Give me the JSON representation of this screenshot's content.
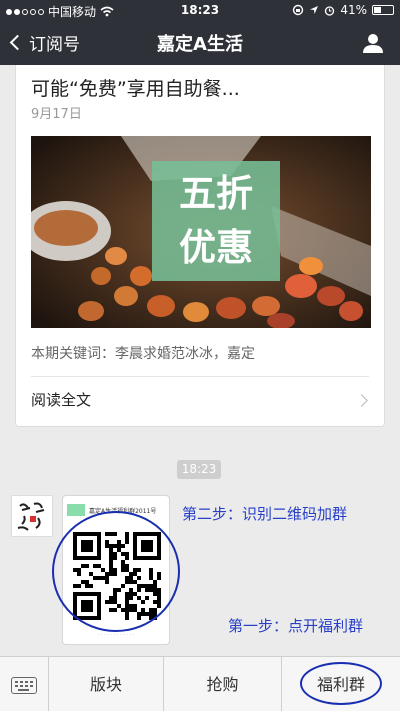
{
  "status_bar": {
    "carrier": "中国移动",
    "time": "18:23",
    "battery_percent": "41%",
    "battery_level": 0.41
  },
  "nav": {
    "back_label": "订阅号",
    "title": "嘉定A生活"
  },
  "article": {
    "title": "可能“免费”享用自助餐...",
    "date": "9月17日",
    "image_overlay_line1": "五折",
    "image_overlay_line2": "优惠",
    "keywords": "本期关键词：李晨求婚范冰冰，嘉定",
    "read_all": "阅读全文"
  },
  "chat": {
    "timestamp": "18:23",
    "qr_header": "嘉定A生活福利群2011号",
    "annotation_step2": "第二步：识别二维码加群",
    "annotation_step1": "第一步：点开福利群"
  },
  "bottom_menu": {
    "items": [
      "版块",
      "抢购",
      "福利群"
    ]
  },
  "colors": {
    "nav_bg": "#2e3238",
    "annotation_blue": "#2840c8",
    "overlay_green": "#76be96"
  }
}
